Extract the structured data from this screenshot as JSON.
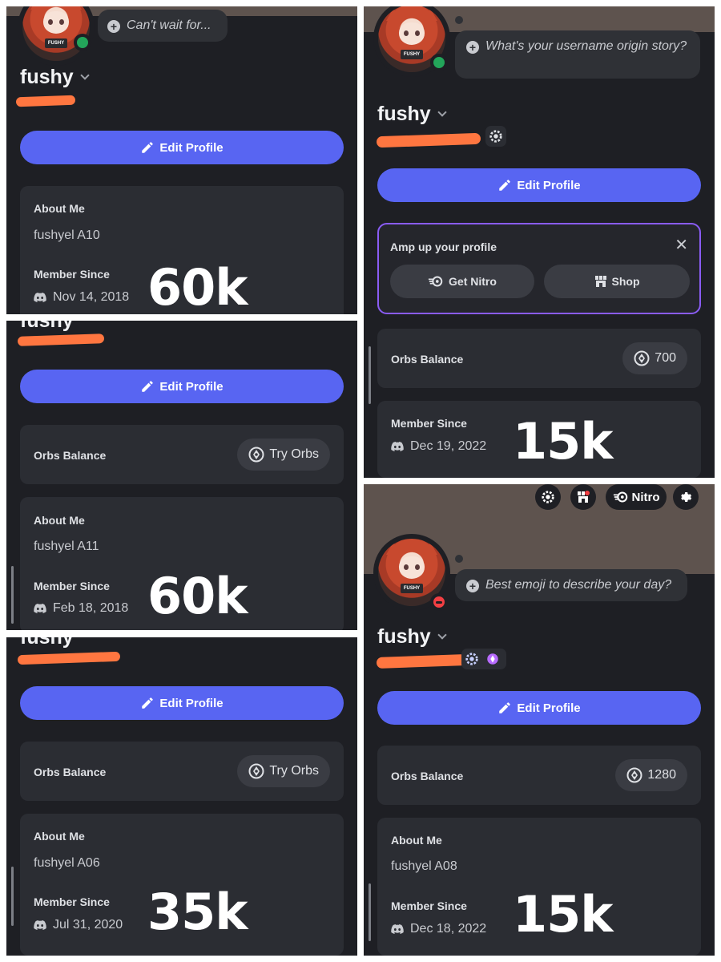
{
  "panels": [
    {
      "bubble": "Can't wait for...",
      "username": "fushy",
      "edit_label": "Edit Profile",
      "about_title": "About Me",
      "about_text": "fushyel A10",
      "member_title": "Member Since",
      "member_date": "Nov 14, 2018",
      "overlay": "60k"
    },
    {
      "username_clipped": "fushy",
      "edit_label": "Edit Profile",
      "orbs_title": "Orbs Balance",
      "orbs_button": "Try Orbs",
      "about_title": "About Me",
      "about_text": "fushyel A11",
      "member_title": "Member Since",
      "member_date": "Feb 18, 2018",
      "overlay": "60k"
    },
    {
      "username_clipped": "fushy",
      "edit_label": "Edit Profile",
      "orbs_title": "Orbs Balance",
      "orbs_button": "Try Orbs",
      "about_title": "About Me",
      "about_text": "fushyel A06",
      "member_title": "Member Since",
      "member_date": "Jul 31, 2020",
      "overlay": "35k"
    },
    {
      "bubble": "What's your username origin story?",
      "username": "fushy",
      "edit_label": "Edit Profile",
      "amp_title": "Amp up your profile",
      "amp_nitro": "Get Nitro",
      "amp_shop": "Shop",
      "orbs_title": "Orbs Balance",
      "orbs_value": "700",
      "member_title": "Member Since",
      "member_date": "Dec 19, 2022",
      "overlay": "15k"
    },
    {
      "top_nitro": "Nitro",
      "bubble": "Best emoji to describe your day?",
      "username": "fushy",
      "edit_label": "Edit Profile",
      "orbs_title": "Orbs Balance",
      "orbs_value": "1280",
      "about_title": "About Me",
      "about_text": "fushyel A08",
      "member_title": "Member Since",
      "member_date": "Dec 18, 2022",
      "overlay": "15k"
    }
  ],
  "avatar_sign": "FUSHY",
  "icons": [
    "pencil-icon",
    "discord-icon",
    "orb-icon",
    "nitro-icon",
    "shop-icon",
    "close-icon",
    "settings-icon",
    "quest-badge-icon",
    "nitro-badge-icon"
  ],
  "colors": {
    "accent": "#5865f2",
    "panel": "#1e1f24",
    "card": "#2b2d33",
    "redaction": "#ff7640",
    "online": "#23a55a",
    "dnd": "#f23f43",
    "amp_border": "#8a5cf5"
  }
}
